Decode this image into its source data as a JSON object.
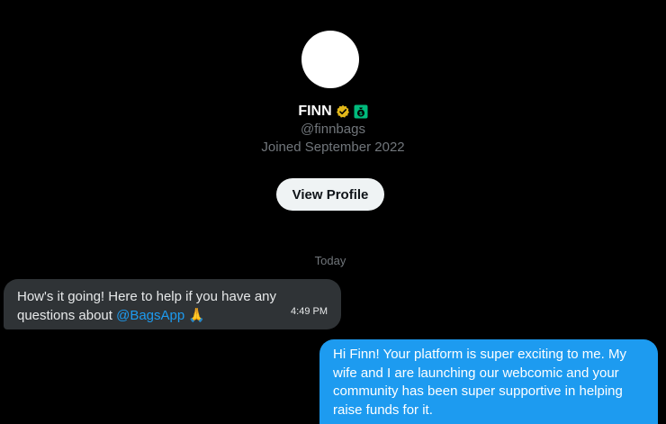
{
  "profile": {
    "display_name": "FINN",
    "handle": "@finnbags",
    "joined": "Joined September 2022",
    "view_profile_label": "View Profile"
  },
  "conversation": {
    "date_separator": "Today",
    "messages": [
      {
        "direction": "incoming",
        "text_before": "How's it going! Here to help if you have any questions about ",
        "mention": "@BagsApp",
        "emoji": "🙏",
        "time": "4:49 PM"
      },
      {
        "direction": "outgoing",
        "text": "Hi Finn! Your platform is super exciting to me. My wife and I are launching our webcomic and your community has been super supportive in helping raise funds for it."
      }
    ]
  },
  "icons": {
    "verified": "verified-badge-icon",
    "affiliate": "money-bag-icon"
  },
  "colors": {
    "background": "#000000",
    "accent": "#1d9bf0",
    "incoming_bubble": "#2f3336",
    "verified_gold": "#e2b719",
    "bag_green": "#00ba7c"
  }
}
